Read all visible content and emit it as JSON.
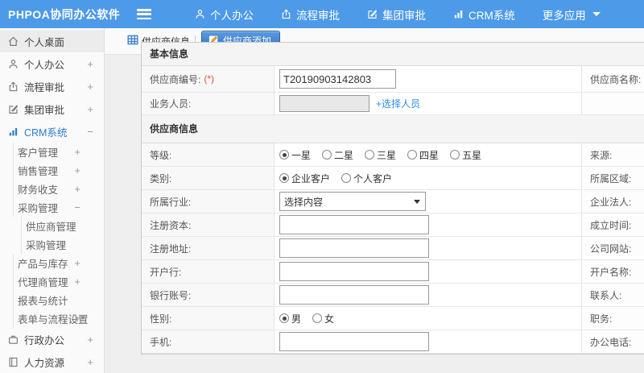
{
  "app": {
    "title": "PHPOA协同办公软件"
  },
  "colors": {
    "topbar": "#4d9ae9",
    "link": "#2d8cf0",
    "required": "#e74c3c",
    "tab_active_top": "#5a9be0",
    "tab_active_bottom": "#2f6fc1",
    "sidebar_active": "#2d7cd4"
  },
  "topnav": {
    "hamburger_icon": "menu-icon",
    "items": [
      {
        "label": "个人办公",
        "icon": "user-icon"
      },
      {
        "label": "流程审批",
        "icon": "upload-icon"
      },
      {
        "label": "集团审批",
        "icon": "edit-icon"
      },
      {
        "label": "CRM系统",
        "icon": "chart-icon"
      },
      {
        "label": "更多应用",
        "icon": "caret-down-icon",
        "has_caret": true
      }
    ]
  },
  "sidebar": {
    "items": [
      {
        "label": "个人桌面",
        "icon": "home-icon",
        "level": 0,
        "expand": "",
        "first": true
      },
      {
        "label": "个人办公",
        "icon": "user-icon",
        "level": 0,
        "expand": "+"
      },
      {
        "label": "流程审批",
        "icon": "upload-icon",
        "level": 0,
        "expand": "+"
      },
      {
        "label": "集团审批",
        "icon": "edit-icon",
        "level": 0,
        "expand": "+"
      },
      {
        "label": "CRM系统",
        "icon": "chart-icon",
        "level": 0,
        "expand": "−",
        "active": true
      },
      {
        "label": "客户管理",
        "level": 1,
        "expand": "+"
      },
      {
        "label": "销售管理",
        "level": 1,
        "expand": "+"
      },
      {
        "label": "财务收支",
        "level": 1,
        "expand": "+"
      },
      {
        "label": "采购管理",
        "level": 1,
        "expand": "−"
      },
      {
        "label": "供应商管理",
        "level": 2,
        "expand": ""
      },
      {
        "label": "采购管理",
        "level": 2,
        "expand": ""
      },
      {
        "label": "产品与库存",
        "level": 1,
        "expand": "+"
      },
      {
        "label": "代理商管理",
        "level": 1,
        "expand": "+"
      },
      {
        "label": "报表与统计",
        "level": 1,
        "expand": ""
      },
      {
        "label": "表单与流程设置",
        "level": 1,
        "expand": "+"
      },
      {
        "label": "行政办公",
        "icon": "briefcase-icon",
        "level": 0,
        "expand": "+"
      },
      {
        "label": "人力资源",
        "icon": "book-icon",
        "level": 0,
        "expand": "+"
      }
    ]
  },
  "tabs": [
    {
      "label": "供应商信息",
      "icon": "table-icon",
      "active": false
    },
    {
      "label": "供应商添加",
      "icon": "pencil-badge-icon",
      "active": true
    }
  ],
  "form": {
    "required_marker": "(*)",
    "sections": [
      {
        "title": "基本信息",
        "rows": [
          {
            "left": "供应商编号:",
            "left_required": true,
            "type": "text",
            "value": "T20190903142803",
            "input_w": "w145",
            "right": "供应商名称:",
            "right_required": true,
            "rh": "h33"
          },
          {
            "left": "业务人员:",
            "type": "disabled",
            "link": "+选择人员",
            "right": "",
            "rh": "h28"
          }
        ]
      },
      {
        "title": "供应商信息",
        "rows": [
          {
            "left": "等级:",
            "type": "radio",
            "options": [
              "一星",
              "二星",
              "三星",
              "四星",
              "五星"
            ],
            "checked": 0,
            "right": "来源:"
          },
          {
            "left": "类别:",
            "type": "radio",
            "options": [
              "企业客户",
              "个人客户"
            ],
            "checked": 0,
            "right": "所属区域:"
          },
          {
            "left": "所属行业:",
            "type": "select",
            "value": "选择内容",
            "right": "企业法人:"
          },
          {
            "left": "注册资本:",
            "type": "text",
            "value": "",
            "input_w": "w186",
            "right": "成立时间:"
          },
          {
            "left": "注册地址:",
            "type": "text",
            "value": "",
            "input_w": "w186",
            "right": "公司网站:"
          },
          {
            "left": "开户行:",
            "type": "text",
            "value": "",
            "input_w": "w186",
            "right": "开户名称:"
          },
          {
            "left": "银行账号:",
            "type": "text",
            "value": "",
            "input_w": "w186",
            "right": "联系人:"
          },
          {
            "left": "性别:",
            "type": "radio",
            "options": [
              "男",
              "女"
            ],
            "checked": 0,
            "right": "职务:"
          },
          {
            "left": "手机:",
            "type": "text",
            "value": "",
            "input_w": "w186",
            "right": "办公电话:"
          }
        ]
      }
    ]
  }
}
